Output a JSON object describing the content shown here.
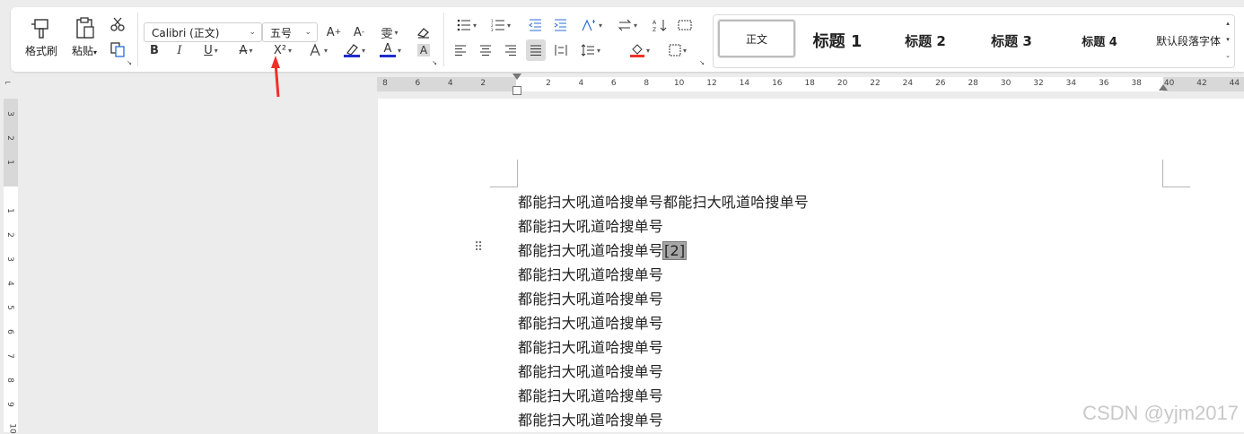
{
  "ribbon": {
    "format_painter_label": "格式刷",
    "paste_label": "粘贴",
    "font_name": "Calibri (正文)",
    "font_size": "五号",
    "bold": "B",
    "italic": "I",
    "underline": "U",
    "superscript": "X²",
    "style_items": [
      {
        "label": "正文"
      },
      {
        "label": "标题 1"
      },
      {
        "label": "标题 2"
      },
      {
        "label": "标题 3"
      },
      {
        "label": "标题 4"
      },
      {
        "label": "默认段落字体"
      }
    ]
  },
  "ruler": {
    "h_ticks": [
      "8",
      "6",
      "4",
      "2",
      "2",
      "4",
      "6",
      "8",
      "10",
      "12",
      "14",
      "16",
      "18",
      "20",
      "22",
      "24",
      "26",
      "28",
      "30",
      "32",
      "34",
      "36",
      "38",
      "40",
      "42",
      "44"
    ],
    "v_ticks": [
      "3",
      "2",
      "1",
      "1",
      "2",
      "3",
      "4",
      "5",
      "6",
      "7",
      "8",
      "9",
      "10"
    ]
  },
  "document": {
    "lines": [
      "都能扫大吼道哈搜单号都能扫大吼道哈搜单号",
      "都能扫大吼道哈搜单号",
      "都能扫大吼道哈搜单号",
      "都能扫大吼道哈搜单号",
      "都能扫大吼道哈搜单号",
      "都能扫大吼道哈搜单号",
      "都能扫大吼道哈搜单号",
      "都能扫大吼道哈搜单号",
      "都能扫大吼道哈搜单号",
      "都能扫大吼道哈搜单号"
    ],
    "reference_mark": "[2]"
  },
  "watermark": "CSDN @yjm2017",
  "colors": {
    "annotation_arrow": "#f03028",
    "highlight_bar": "#1f2ccf",
    "font_color_bar": "#1f2ccf",
    "selection": "#a6a6a6"
  }
}
